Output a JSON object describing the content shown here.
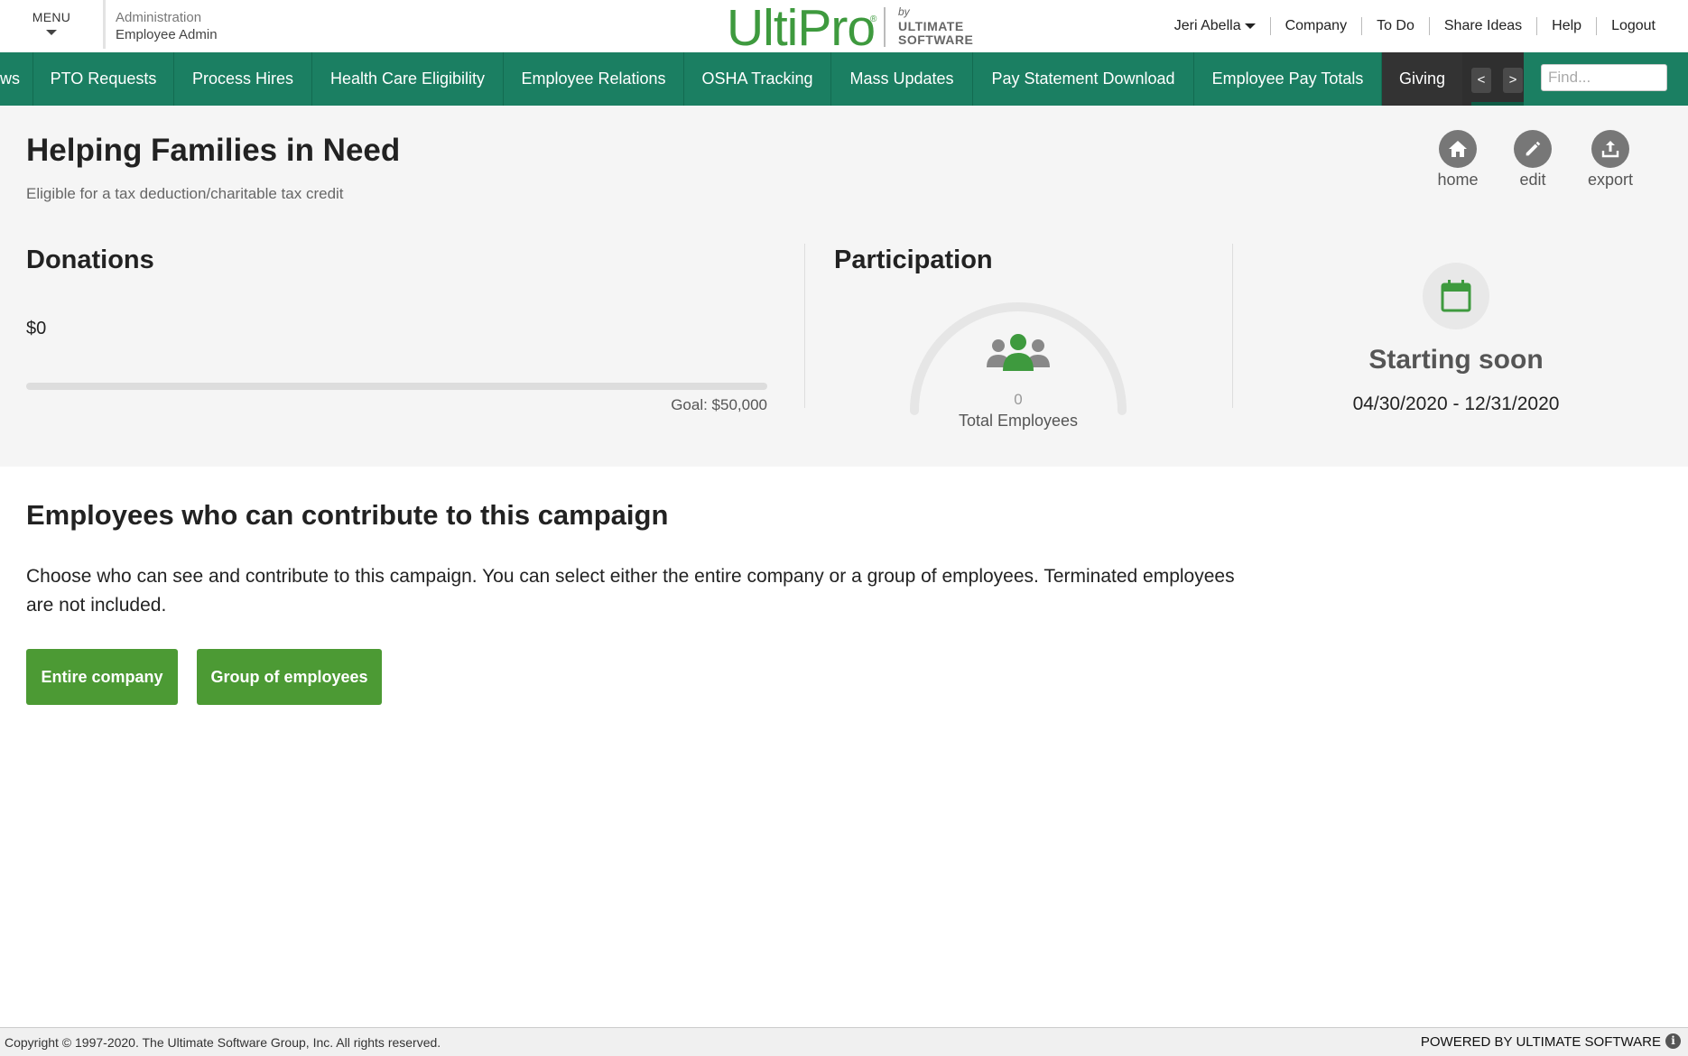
{
  "header": {
    "menu_label": "MENU",
    "admin_line1": "Administration",
    "admin_line2": "Employee Admin",
    "logo": {
      "brand": "UltiPro",
      "by": "by",
      "company_line1": "ULTIMATE",
      "company_line2": "SOFTWARE"
    },
    "user_name": "Jeri Abella",
    "links": [
      "Company",
      "To Do",
      "Share Ideas",
      "Help",
      "Logout"
    ]
  },
  "nav": {
    "tabs": [
      {
        "label": "ws",
        "active": false
      },
      {
        "label": "PTO Requests",
        "active": false
      },
      {
        "label": "Process Hires",
        "active": false
      },
      {
        "label": "Health Care Eligibility",
        "active": false
      },
      {
        "label": "Employee Relations",
        "active": false
      },
      {
        "label": "OSHA Tracking",
        "active": false
      },
      {
        "label": "Mass Updates",
        "active": false
      },
      {
        "label": "Pay Statement Download",
        "active": false
      },
      {
        "label": "Employee Pay Totals",
        "active": false
      },
      {
        "label": "Giving",
        "active": true
      }
    ],
    "prev_label": "<",
    "next_label": ">",
    "find_placeholder": "Find..."
  },
  "campaign": {
    "title": "Helping Families in Need",
    "subtitle": "Eligible for a tax deduction/charitable tax credit",
    "actions": [
      {
        "label": "home",
        "icon": "home-icon"
      },
      {
        "label": "edit",
        "icon": "edit-icon"
      },
      {
        "label": "export",
        "icon": "export-icon"
      }
    ],
    "donations": {
      "title": "Donations",
      "amount": "$0",
      "goal": "Goal: $50,000",
      "progress_fraction": 0
    },
    "participation": {
      "title": "Participation",
      "count": "0",
      "label": "Total Employees",
      "progress_fraction": 0
    },
    "schedule": {
      "status": "Starting soon",
      "date_range": "04/30/2020 - 12/31/2020",
      "icon": "calendar-icon"
    }
  },
  "contribute": {
    "title": "Employees who can contribute to this campaign",
    "description": "Choose who can see and contribute to this campaign. You can select either the entire company or a group of employees. Terminated employees are not included.",
    "buttons": [
      "Entire company",
      "Group of employees"
    ]
  },
  "footer": {
    "copyright": "Copyright © 1997-2020. The Ultimate Software Group, Inc. All rights reserved.",
    "powered_by": "POWERED BY ULTIMATE SOFTWARE",
    "info_glyph": "i"
  },
  "colors": {
    "nav_green": "#1b7f62",
    "active_tab": "#333333",
    "button_green": "#4c9a34",
    "brand_green": "#3e9a3e",
    "summary_bg": "#f5f5f5"
  }
}
